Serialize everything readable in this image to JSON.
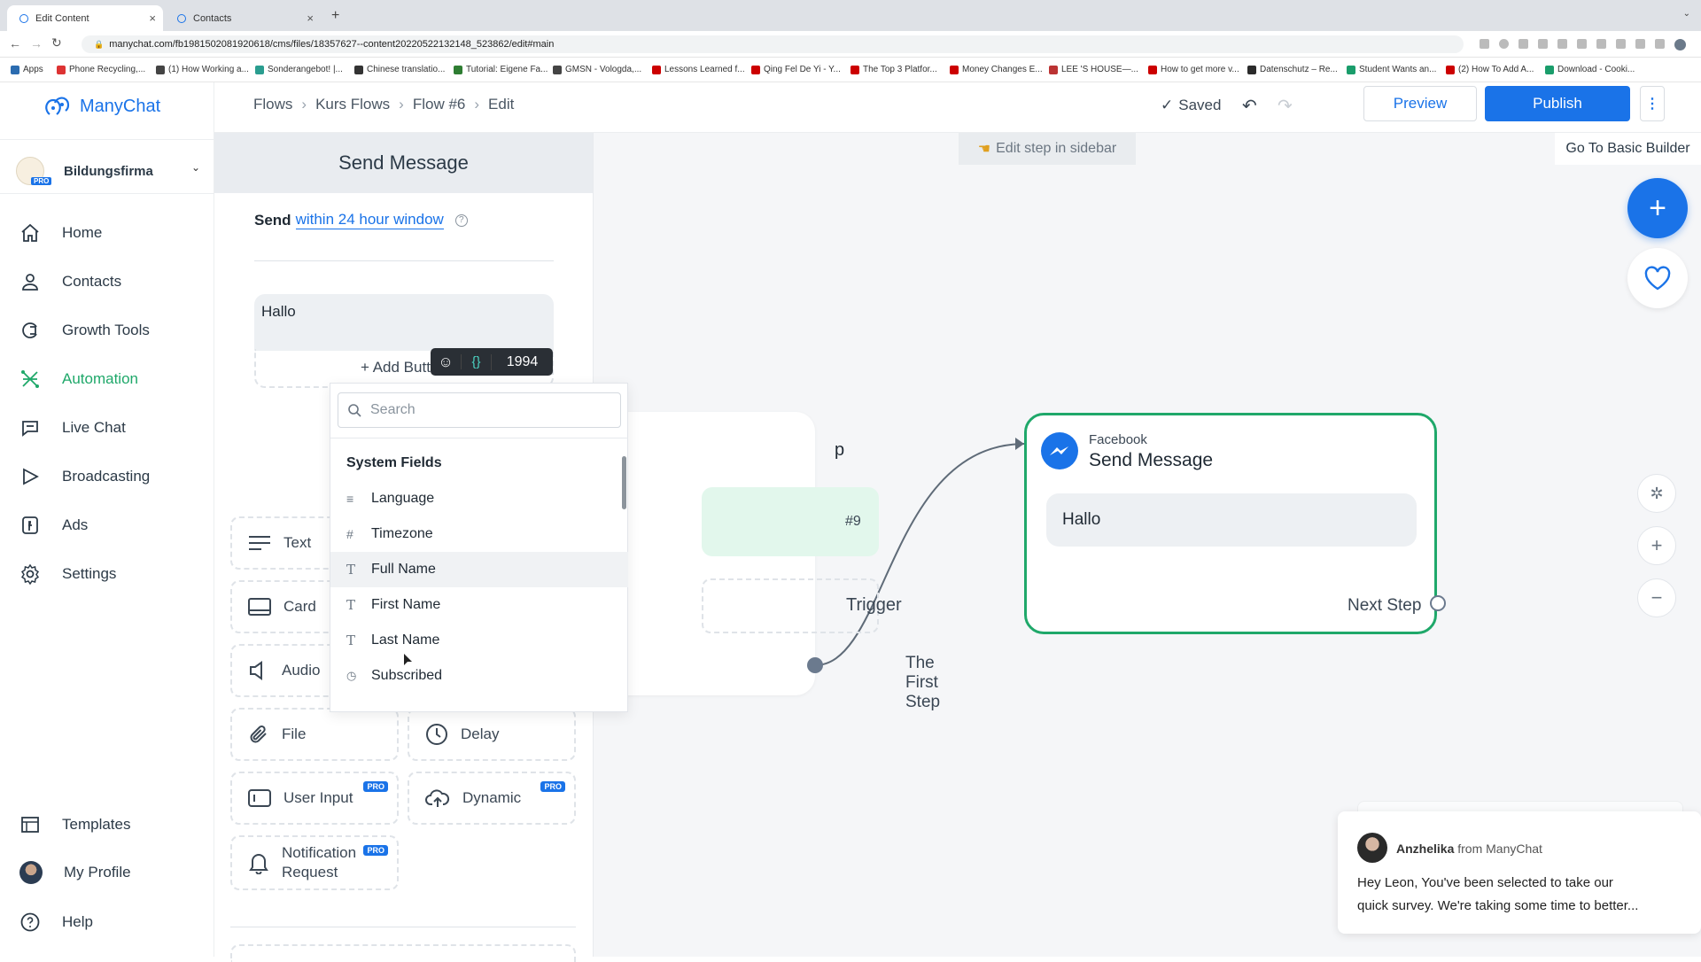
{
  "browser": {
    "tabs": [
      {
        "label": "Edit Content"
      },
      {
        "label": "Contacts"
      }
    ],
    "url": "manychat.com/fb198150208192061​8/cms/files/18357627--content20220522132148_523862/edit#main",
    "bookmarks": [
      "Apps",
      "Phone Recycling,...",
      "(1) How Working a...",
      "Sonderangebot! |...",
      "Chinese translatio...",
      "Tutorial: Eigene Fa...",
      "GMSN - Vologda,...",
      "Lessons Learned f...",
      "Qing Fel De Yi - Y...",
      "The Top 3 Platfor...",
      "Money Changes E...",
      "LEE 'S HOUSE—...",
      "How to get more v...",
      "Datenschutz – Re...",
      "Student Wants an...",
      "(2) How To Add A...",
      "Download - Cooki..."
    ]
  },
  "brand": {
    "name": "ManyChat",
    "accent": "#1a73e8",
    "green": "#1fa86a"
  },
  "account": {
    "name": "Bildungsfirma",
    "badge": "PRO"
  },
  "nav": {
    "items": [
      {
        "label": "Home",
        "icon": "home-icon"
      },
      {
        "label": "Contacts",
        "icon": "contacts-icon"
      },
      {
        "label": "Growth Tools",
        "icon": "growth-tools-icon"
      },
      {
        "label": "Automation",
        "icon": "automation-icon"
      },
      {
        "label": "Live Chat",
        "icon": "live-chat-icon"
      },
      {
        "label": "Broadcasting",
        "icon": "broadcasting-icon"
      },
      {
        "label": "Ads",
        "icon": "ads-icon"
      },
      {
        "label": "Settings",
        "icon": "settings-icon"
      }
    ],
    "bottom": [
      {
        "label": "Templates"
      },
      {
        "label": "My Profile"
      },
      {
        "label": "Help"
      }
    ]
  },
  "breadcrumb": [
    "Flows",
    "Kurs Flows",
    "Flow #6",
    "Edit"
  ],
  "toolbar": {
    "saved": "Saved",
    "preview": "Preview",
    "publish": "Publish"
  },
  "canvas_top": {
    "edit_hint": "Edit step in sidebar",
    "basic_builder": "Go To Basic Builder"
  },
  "panel": {
    "title": "Send Message",
    "send_prefix": "Send",
    "send_link": "within 24 hour window",
    "message_text": "Hallo",
    "add_button": "+ Add Butt",
    "char_count": "1994",
    "tiles": [
      {
        "label": "Text"
      },
      {
        "label": "Card"
      },
      {
        "label": "Audio"
      },
      {
        "label": "File"
      },
      {
        "label": "Delay"
      },
      {
        "label": "User Input",
        "badge": "PRO"
      },
      {
        "label": "Dynamic",
        "badge": "PRO"
      },
      {
        "label": "Notification Request",
        "badge": "PRO"
      }
    ]
  },
  "dropdown": {
    "search_placeholder": "Search",
    "section": "System Fields",
    "items": [
      {
        "label": "Language",
        "icon": "list-icon"
      },
      {
        "label": "Timezone",
        "icon": "hash-icon"
      },
      {
        "label": "Full Name",
        "icon": "text-icon"
      },
      {
        "label": "First Name",
        "icon": "text-icon"
      },
      {
        "label": "Last Name",
        "icon": "text-icon"
      },
      {
        "label": "Subscribed",
        "icon": "clock-icon"
      }
    ]
  },
  "start_node": {
    "partial_title": "p",
    "chip": "#9",
    "trigger": "Trigger",
    "first_step": "The First Step"
  },
  "message_node": {
    "channel": "Facebook",
    "title": "Send Message",
    "bubble": "Hallo",
    "next": "Next Step"
  },
  "chat_popup": {
    "sender": "Anzhelika",
    "from": "from ManyChat",
    "line1": "Hey Leon,  You've been selected to take our",
    "line2": "quick survey. We're taking some time to better..."
  }
}
